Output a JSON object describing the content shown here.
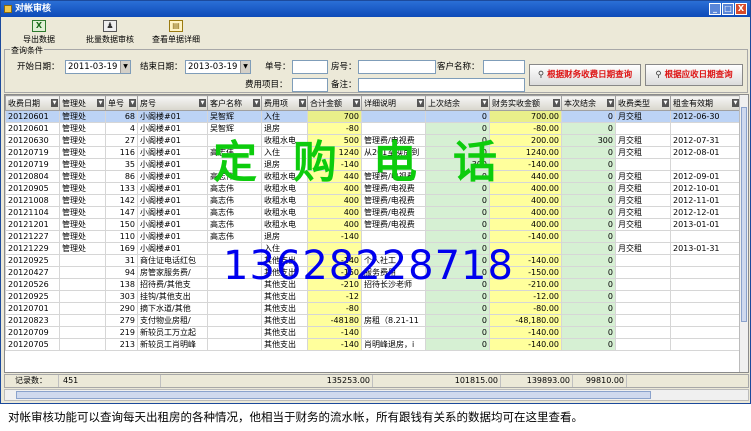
{
  "window": {
    "title": "对帐审核",
    "min": "_",
    "max": "□",
    "close": "X"
  },
  "toolbar": {
    "export": "导出数据",
    "batch_review": "批量数据审核",
    "view_detail": "查看单据详细"
  },
  "query": {
    "legend": "查询条件",
    "start_label": "开始日期：",
    "start_value": "2011-03-19",
    "end_label": "结束日期：",
    "end_value": "2013-03-19",
    "doc_no_label": "单号：",
    "doc_no_value": "",
    "room_label": "房号：",
    "room_value": "",
    "customer_label": "客户名称：",
    "customer_value": "",
    "fee_label": "费用项目：",
    "fee_value": "",
    "remark_label": "备注：",
    "remark_value": "",
    "btn_fin_date": "根据财务收费日期查询",
    "btn_due_date": "根据应收日期查询"
  },
  "table": {
    "columns": [
      "收费日期",
      "管理处",
      "单号",
      "房号",
      "客户名称",
      "费用项",
      "合计金额",
      "详细说明",
      "上次结余",
      "财务实收金额",
      "本次结余",
      "收费类型",
      "租金有效期"
    ],
    "rows": [
      [
        "20120601",
        "管理处",
        "68",
        "小阁楼#01",
        "吴智辉",
        "入住",
        "700",
        "",
        "0",
        "700.00",
        "0",
        "月交租",
        "2012-06-30"
      ],
      [
        "20120601",
        "管理处",
        "4",
        "小阁楼#01",
        "吴智辉",
        "退房",
        "-80",
        "",
        "0",
        "-80.00",
        "0",
        "",
        ""
      ],
      [
        "20120630",
        "管理处",
        "27",
        "小阁楼#01",
        "",
        "收租水电",
        "500",
        "管理费/电视费",
        "0",
        "200.00",
        "300",
        "月交租",
        "2012-07-31"
      ],
      [
        "20120719",
        "管理处",
        "116",
        "小阁楼#01",
        "高志伟",
        "入住",
        "1240",
        "从201室换房到",
        "0",
        "1240.00",
        "0",
        "月交租",
        "2012-08-01"
      ],
      [
        "20120719",
        "管理处",
        "35",
        "小阁楼#01",
        "",
        "退房",
        "-140",
        "",
        "300",
        "-140.00",
        "0",
        "",
        ""
      ],
      [
        "20120804",
        "管理处",
        "86",
        "小阁楼#01",
        "高志伟",
        "收租水电",
        "440",
        "管理费/电视费",
        "0",
        "440.00",
        "0",
        "月交租",
        "2012-09-01"
      ],
      [
        "20120905",
        "管理处",
        "133",
        "小阁楼#01",
        "高志伟",
        "收租水电",
        "400",
        "管理费/电视费",
        "0",
        "400.00",
        "0",
        "月交租",
        "2012-10-01"
      ],
      [
        "20121008",
        "管理处",
        "142",
        "小阁楼#01",
        "高志伟",
        "收租水电",
        "400",
        "管理费/电视费",
        "0",
        "400.00",
        "0",
        "月交租",
        "2012-11-01"
      ],
      [
        "20121104",
        "管理处",
        "147",
        "小阁楼#01",
        "高志伟",
        "收租水电",
        "400",
        "管理费/电视费",
        "0",
        "400.00",
        "0",
        "月交租",
        "2012-12-01"
      ],
      [
        "20121201",
        "管理处",
        "150",
        "小阁楼#01",
        "高志伟",
        "收租水电",
        "400",
        "管理费/电视费",
        "0",
        "400.00",
        "0",
        "月交租",
        "2013-01-01"
      ],
      [
        "20121227",
        "管理处",
        "110",
        "小阁楼#01",
        "高志伟",
        "退房",
        "-140",
        "",
        "0",
        "-140.00",
        "0",
        "",
        ""
      ],
      [
        "20121229",
        "管理处",
        "169",
        "小阁楼#01",
        "",
        "入住",
        "",
        "",
        "0",
        "",
        "0",
        "月交租",
        "2013-01-31"
      ],
      [
        "20120925",
        "",
        "31",
        "商住证电话红包",
        "",
        "其他支出",
        "-140",
        "个人社工",
        "0",
        "-140.00",
        "0",
        "",
        ""
      ],
      [
        "20120427",
        "",
        "94",
        "房管家服务费/",
        "",
        "其他支出",
        "-150",
        "服务费用",
        "0",
        "-150.00",
        "0",
        "",
        ""
      ],
      [
        "20120526",
        "",
        "138",
        "招待费/其他支",
        "",
        "其他支出",
        "-210",
        "招待长沙老师",
        "0",
        "-210.00",
        "0",
        "",
        ""
      ],
      [
        "20120925",
        "",
        "303",
        "挂钩/其他支出",
        "",
        "其他支出",
        "-12",
        "",
        "0",
        "-12.00",
        "0",
        "",
        ""
      ],
      [
        "20120701",
        "",
        "290",
        "摘下水道/其他",
        "",
        "其他支出",
        "-80",
        "",
        "0",
        "-80.00",
        "0",
        "",
        ""
      ],
      [
        "20120823",
        "",
        "279",
        "支付物业房租/",
        "",
        "其他支出",
        "-48180",
        "房租（8.21-11",
        "0",
        "-48,180.00",
        "0",
        "",
        ""
      ],
      [
        "20120709",
        "",
        "219",
        "新较员工万立起",
        "",
        "其他支出",
        "-140",
        "",
        "0",
        "-140.00",
        "0",
        "",
        ""
      ],
      [
        "20120705",
        "",
        "213",
        "新较员工肖明峰",
        "",
        "其他支出",
        "-140",
        "肖明峰退房，i",
        "0",
        "-140.00",
        "0",
        "",
        ""
      ]
    ]
  },
  "summary": {
    "count_label": "记录数：",
    "count": "451",
    "total": "135253.00",
    "prev_balance": "101815.00",
    "actual": "139893.00",
    "cur_balance": "99810.00"
  },
  "watermark": {
    "line1": "定购电话",
    "line2": "13628228718"
  },
  "caption": "对帐审核功能可以查询每天出租房的各种情况，他相当于财务的流水帐，所有跟钱有关系的数据均可在这里查看。",
  "colors": {
    "titlebar": "#0d4ab8",
    "yellow_col": "#ffff9c",
    "green_col": "#d6f0d3",
    "watermark_green": "#0dcc0d",
    "watermark_blue": "#0000ee"
  }
}
